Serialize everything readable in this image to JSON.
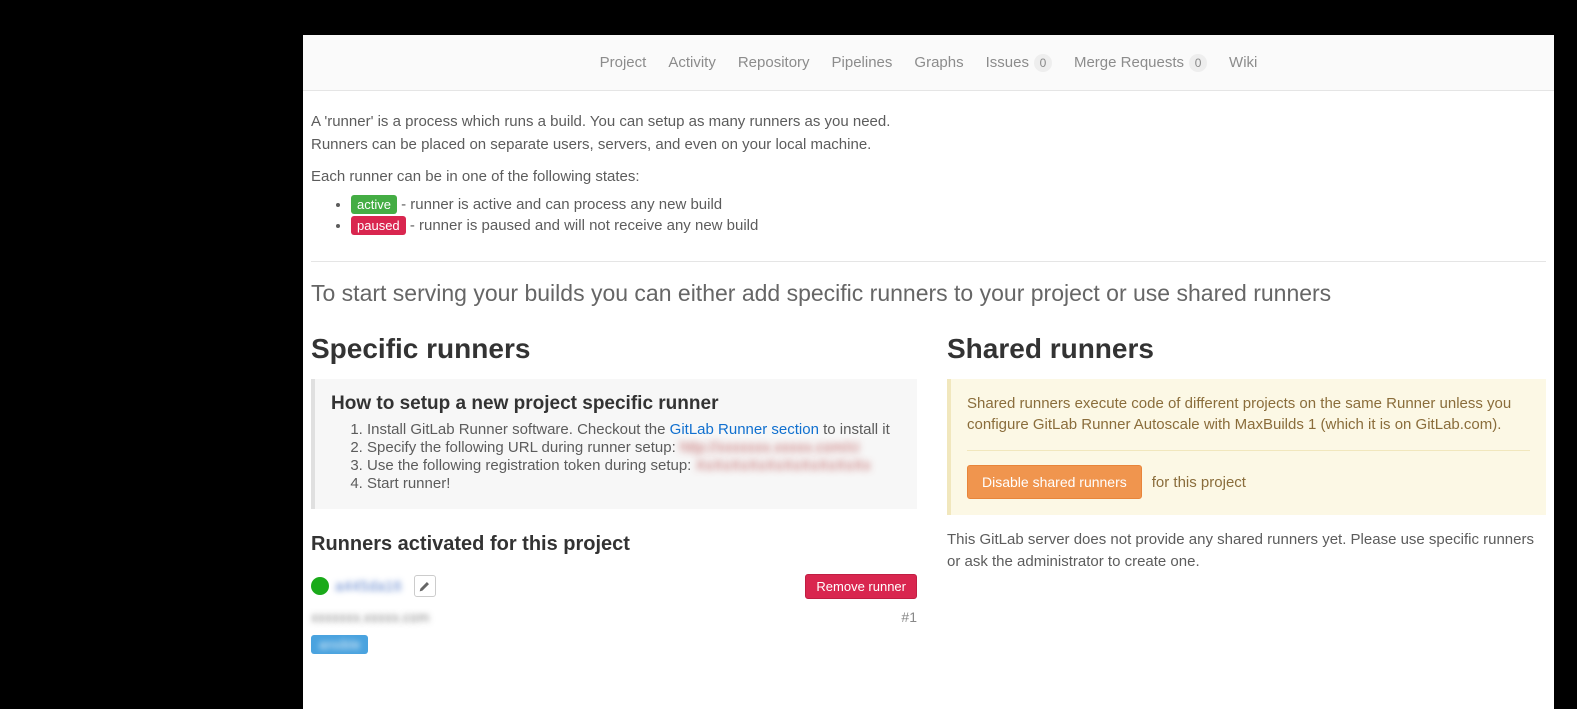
{
  "nav": {
    "project": "Project",
    "activity": "Activity",
    "repository": "Repository",
    "pipelines": "Pipelines",
    "graphs": "Graphs",
    "issues": "Issues",
    "issues_count": "0",
    "merge_requests": "Merge Requests",
    "merge_requests_count": "0",
    "wiki": "Wiki"
  },
  "intro": {
    "line1": "A 'runner' is a process which runs a build. You can setup as many runners as you need.",
    "line2": "Runners can be placed on separate users, servers, and even on your local machine.",
    "states_line": "Each runner can be in one of the following states:",
    "active_label": "active",
    "active_desc": " - runner is active and can process any new build",
    "paused_label": "paused",
    "paused_desc": " - runner is paused and will not receive any new build"
  },
  "lead": "To start serving your builds you can either add specific runners to your project or use shared runners",
  "specific": {
    "title": "Specific runners",
    "howto_title": "How to setup a new project specific runner",
    "step1_pre": "Install GitLab Runner software. Checkout the ",
    "step1_link": "GitLab Runner section",
    "step1_post": " to install it",
    "step2": "Specify the following URL during runner setup: ",
    "step2_blur": "http://xxxxxxx.xxxxx.com/ci",
    "step3": "Use the following registration token during setup: ",
    "step3_blur": "XxXxXxXxXxXxXxXxXxXx",
    "step4": "Start runner!",
    "activated_title": "Runners activated for this project",
    "runner_id_blur": "a445da16",
    "remove_btn": "Remove runner",
    "runner_host_blur": "xxxxxxx.xxxxx.com",
    "runner_num": "#1",
    "tag_blur": "ansible"
  },
  "shared": {
    "title": "Shared runners",
    "panel_text": "Shared runners execute code of different projects on the same Runner unless you configure GitLab Runner Autoscale with MaxBuilds 1 (which it is on GitLab.com).",
    "disable_btn": "Disable shared runners",
    "for_project": "for this project",
    "note": "This GitLab server does not provide any shared runners yet. Please use specific runners or ask the administrator to create one."
  }
}
